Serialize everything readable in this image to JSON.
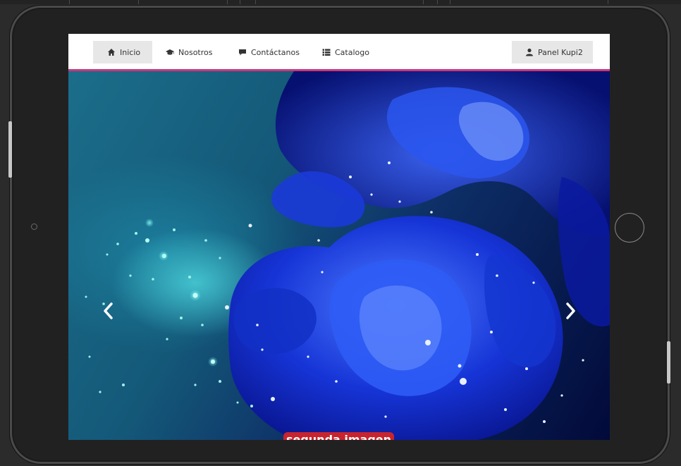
{
  "navbar": {
    "left_items": [
      {
        "label": "Inicio",
        "icon": "home-icon",
        "active": true
      },
      {
        "label": "Nosotros",
        "icon": "graduation-cap-icon",
        "active": false
      },
      {
        "label": "Contáctanos",
        "icon": "comment-icon",
        "active": false
      },
      {
        "label": "Catalogo",
        "icon": "list-icon",
        "active": false
      }
    ],
    "right_item": {
      "label": "Panel Kupi2",
      "icon": "user-icon"
    }
  },
  "carousel": {
    "caption": "segunda imagen",
    "prev_icon": "chevron-left-icon",
    "next_icon": "chevron-right-icon"
  },
  "colors": {
    "navbar_border": "#d0367b",
    "caption_bg": "#c8242e",
    "active_tab_bg": "#e7e7e7"
  }
}
